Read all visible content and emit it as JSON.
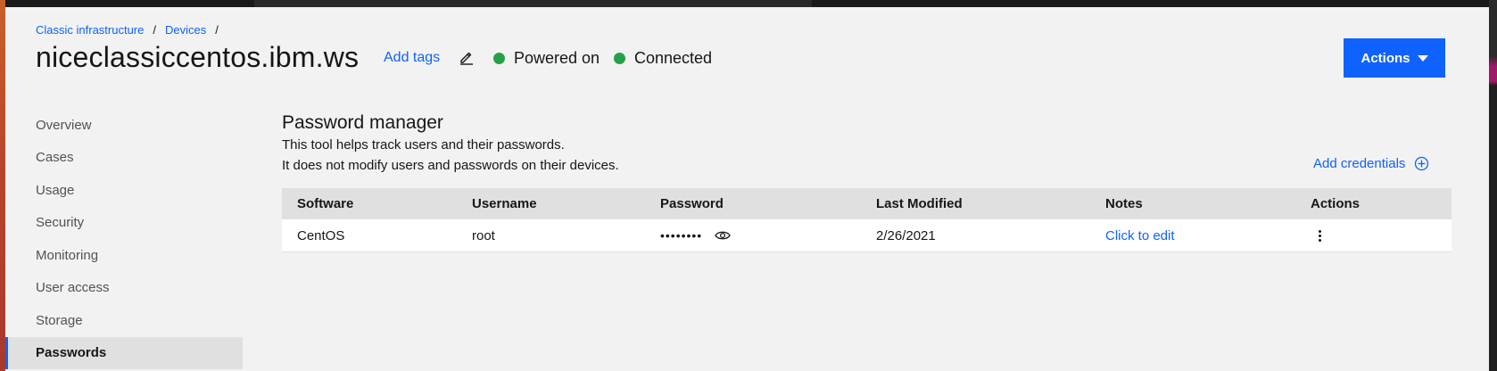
{
  "breadcrumb": {
    "items": [
      "Classic infrastructure",
      "Devices"
    ],
    "separator": "/"
  },
  "header": {
    "title": "niceclassiccentos.ibm.ws",
    "add_tags": "Add tags",
    "edit_icon": "edit-icon",
    "status": [
      {
        "label": "Powered on",
        "color": "#24a148"
      },
      {
        "label": "Connected",
        "color": "#24a148"
      }
    ],
    "actions_label": "Actions"
  },
  "sidebar": {
    "items": [
      {
        "label": "Overview"
      },
      {
        "label": "Cases"
      },
      {
        "label": "Usage"
      },
      {
        "label": "Security"
      },
      {
        "label": "Monitoring"
      },
      {
        "label": "User access"
      },
      {
        "label": "Storage"
      },
      {
        "label": "Passwords",
        "active": true
      }
    ]
  },
  "main": {
    "title": "Password manager",
    "description_1": "This tool helps track users and their passwords.",
    "description_2": "It does not modify users and passwords on their devices.",
    "add_credentials": "Add credentials",
    "table": {
      "columns": [
        "Software",
        "Username",
        "Password",
        "Last Modified",
        "Notes",
        "Actions"
      ],
      "rows": [
        {
          "software": "CentOS",
          "username": "root",
          "password": "••••••••",
          "last_modified": "2/26/2021",
          "notes": "Click to edit"
        }
      ]
    }
  },
  "colors": {
    "accent": "#0f62fe",
    "status_ok": "#24a148"
  }
}
